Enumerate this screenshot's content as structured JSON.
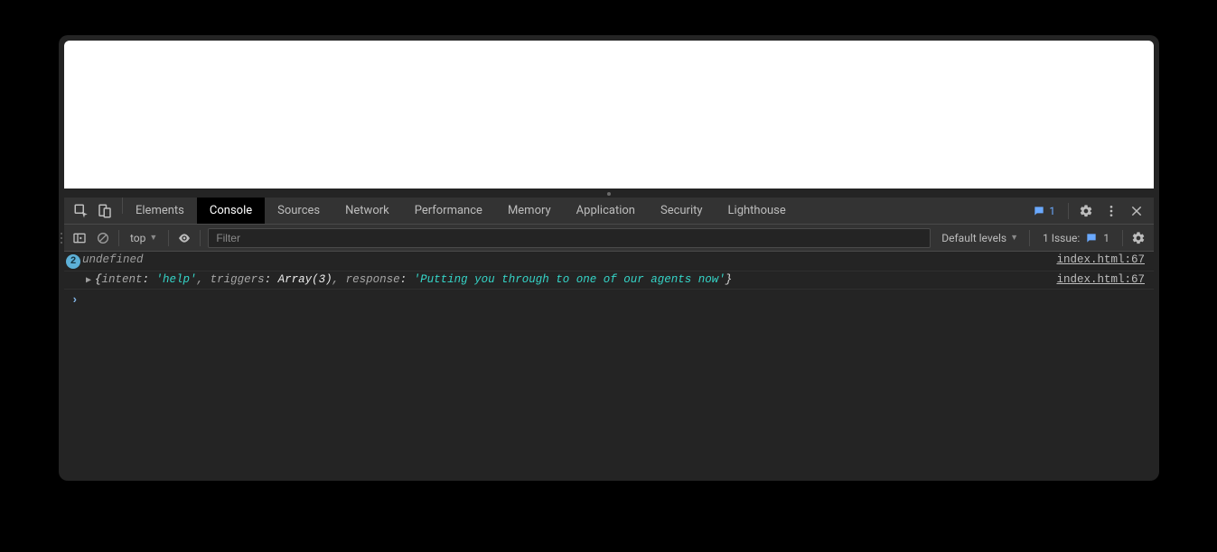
{
  "tabs": {
    "items": [
      {
        "label": "Elements"
      },
      {
        "label": "Console"
      },
      {
        "label": "Sources"
      },
      {
        "label": "Network"
      },
      {
        "label": "Performance"
      },
      {
        "label": "Memory"
      },
      {
        "label": "Application"
      },
      {
        "label": "Security"
      },
      {
        "label": "Lighthouse"
      }
    ],
    "active_index": 1,
    "message_badge_count": "1"
  },
  "filterbar": {
    "context_label": "top",
    "filter_placeholder": "Filter",
    "filter_value": "",
    "levels_label": "Default levels",
    "issue_label": "1 Issue:",
    "issue_count": "1"
  },
  "console": {
    "row1": {
      "count": "2",
      "text": "undefined",
      "source": "index.html:67"
    },
    "row2": {
      "brace_open": "{",
      "k1": "intent",
      "v1": "'help'",
      "k2": "triggers",
      "v2": "Array(3)",
      "k3": "response",
      "v3": "'Putting you through to one of our agents now'",
      "brace_close": "}",
      "source": "index.html:67"
    }
  }
}
